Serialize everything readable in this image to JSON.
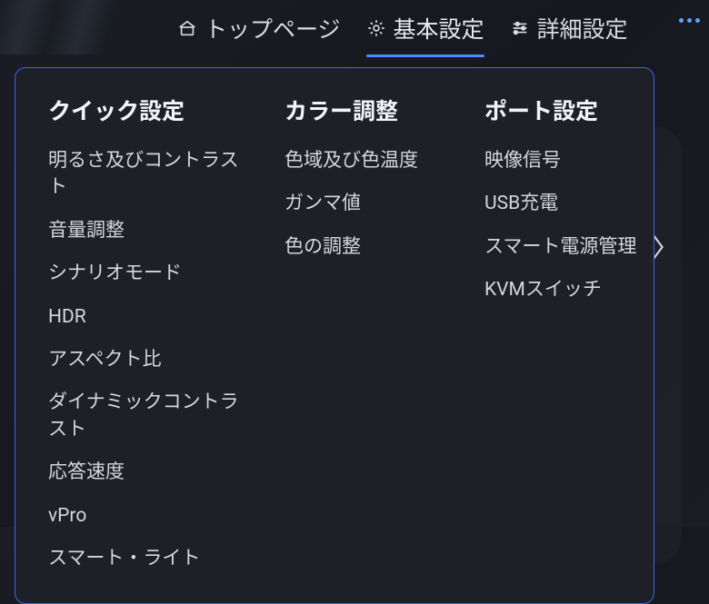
{
  "tabs": {
    "home": {
      "label": "トップページ"
    },
    "basic": {
      "label": "基本設定"
    },
    "advanced": {
      "label": "詳細設定"
    }
  },
  "dropdown": {
    "quick": {
      "header": "クイック設定",
      "items": [
        "明るさ及びコントラスト",
        "音量調整",
        "シナリオモード",
        "HDR",
        "アスペクト比",
        "ダイナミックコントラスト",
        "応答速度",
        "vPro",
        "スマート・ライト"
      ]
    },
    "color": {
      "header": "カラー調整",
      "items": [
        "色域及び色温度",
        "ガンマ値",
        "色の調整"
      ]
    },
    "port": {
      "header": "ポート設定",
      "items": [
        "映像信号",
        "USB充電",
        "スマート電源管理",
        "KVMスイッチ"
      ]
    }
  }
}
